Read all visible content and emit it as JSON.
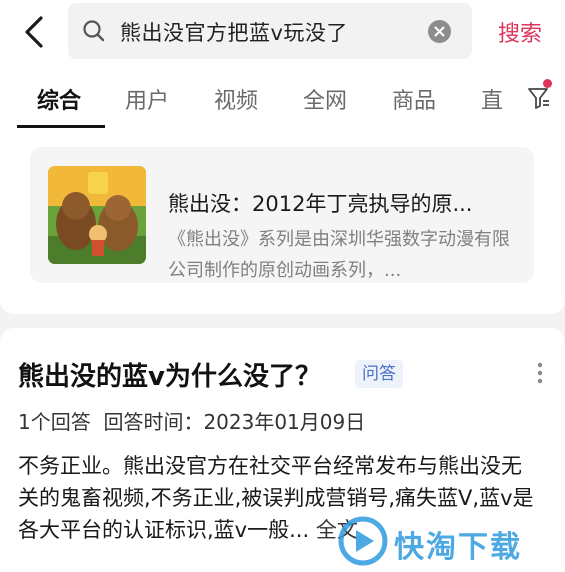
{
  "search": {
    "query": "熊出没官方把蓝v玩没了",
    "button_label": "搜索"
  },
  "tabs": [
    {
      "label": "综合",
      "active": true
    },
    {
      "label": "用户",
      "active": false
    },
    {
      "label": "视频",
      "active": false
    },
    {
      "label": "全网",
      "active": false
    },
    {
      "label": "商品",
      "active": false
    },
    {
      "label": "直",
      "active": false
    }
  ],
  "baike_card": {
    "title": "熊出没：2012年丁亮执导的原...",
    "description": "《熊出没》系列是由深圳华强数字动漫有限公司制作的原创动画系列，..."
  },
  "qa_card": {
    "title": "熊出没的蓝v为什么没了？",
    "badge": "问答",
    "meta": "1个回答  回答时间：2023年01月09日",
    "body": "不务正业。熊出没官方在社交平台经常发布与熊出没无关的鬼畜视频,不务正业,被误判成营销号,痛失蓝V,蓝v是各大平台的认证标识,蓝v一般...",
    "read_more": "全文"
  },
  "watermark": {
    "text": "快淘下载"
  },
  "colors": {
    "accent": "#e0335c",
    "badge_text": "#4a6fc8",
    "watermark": "#2f9be0"
  }
}
